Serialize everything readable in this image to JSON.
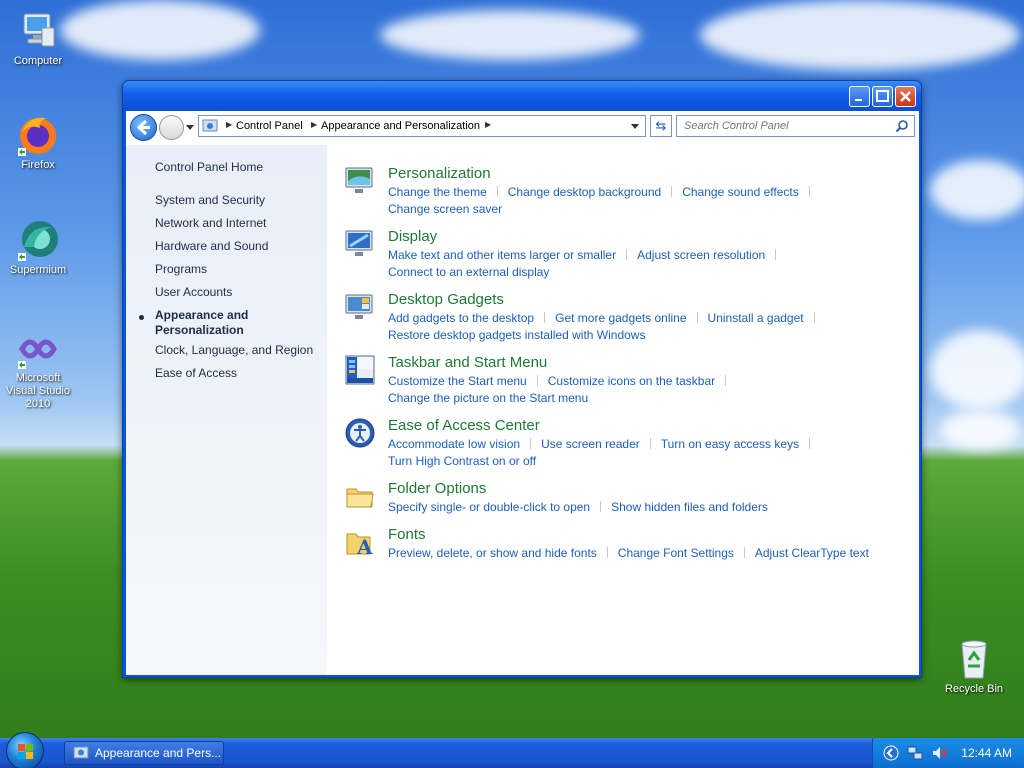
{
  "desktop": {
    "icons": [
      {
        "label": "Computer"
      },
      {
        "label": "Firefox"
      },
      {
        "label": "Supermium"
      },
      {
        "label": "Microsoft Visual Studio 2010"
      },
      {
        "label": "Recycle Bin"
      }
    ]
  },
  "window": {
    "breadcrumb": [
      "Control Panel",
      "Appearance and Personalization"
    ],
    "search": {
      "placeholder": "Search Control Panel",
      "value": ""
    }
  },
  "sidebar": {
    "home": "Control Panel Home",
    "items": [
      {
        "label": "System and Security"
      },
      {
        "label": "Network and Internet"
      },
      {
        "label": "Hardware and Sound"
      },
      {
        "label": "Programs"
      },
      {
        "label": "User Accounts"
      },
      {
        "label": "Appearance and Personalization",
        "active": true
      },
      {
        "label": "Clock, Language, and Region"
      },
      {
        "label": "Ease of Access"
      }
    ]
  },
  "categories": [
    {
      "title": "Personalization",
      "icon": "personalization-icon",
      "links": [
        "Change the theme",
        "Change desktop background",
        "Change sound effects",
        "Change screen saver"
      ]
    },
    {
      "title": "Display",
      "icon": "display-icon",
      "links": [
        "Make text and other items larger or smaller",
        "Adjust screen resolution",
        "Connect to an external display"
      ]
    },
    {
      "title": "Desktop Gadgets",
      "icon": "desktop-gadgets-icon",
      "links": [
        "Add gadgets to the desktop",
        "Get more gadgets online",
        "Uninstall a gadget",
        "Restore desktop gadgets installed with Windows"
      ]
    },
    {
      "title": "Taskbar and Start Menu",
      "icon": "taskbar-icon",
      "links": [
        "Customize the Start menu",
        "Customize icons on the taskbar",
        "Change the picture on the Start menu"
      ]
    },
    {
      "title": "Ease of Access Center",
      "icon": "ease-of-access-icon",
      "links": [
        "Accommodate low vision",
        "Use screen reader",
        "Turn on easy access keys",
        "Turn High Contrast on or off"
      ]
    },
    {
      "title": "Folder Options",
      "icon": "folder-options-icon",
      "links": [
        "Specify single- or double-click to open",
        "Show hidden files and folders"
      ]
    },
    {
      "title": "Fonts",
      "icon": "fonts-icon",
      "links": [
        "Preview, delete, or show and hide fonts",
        "Change Font Settings",
        "Adjust ClearType text"
      ]
    }
  ],
  "taskbar": {
    "active_window": "Appearance and Pers...",
    "clock": "12:44 AM"
  },
  "colors": {
    "link": "#1d5fbd",
    "category_title": "#1e7a34",
    "taskbar": "#1b55cf"
  }
}
